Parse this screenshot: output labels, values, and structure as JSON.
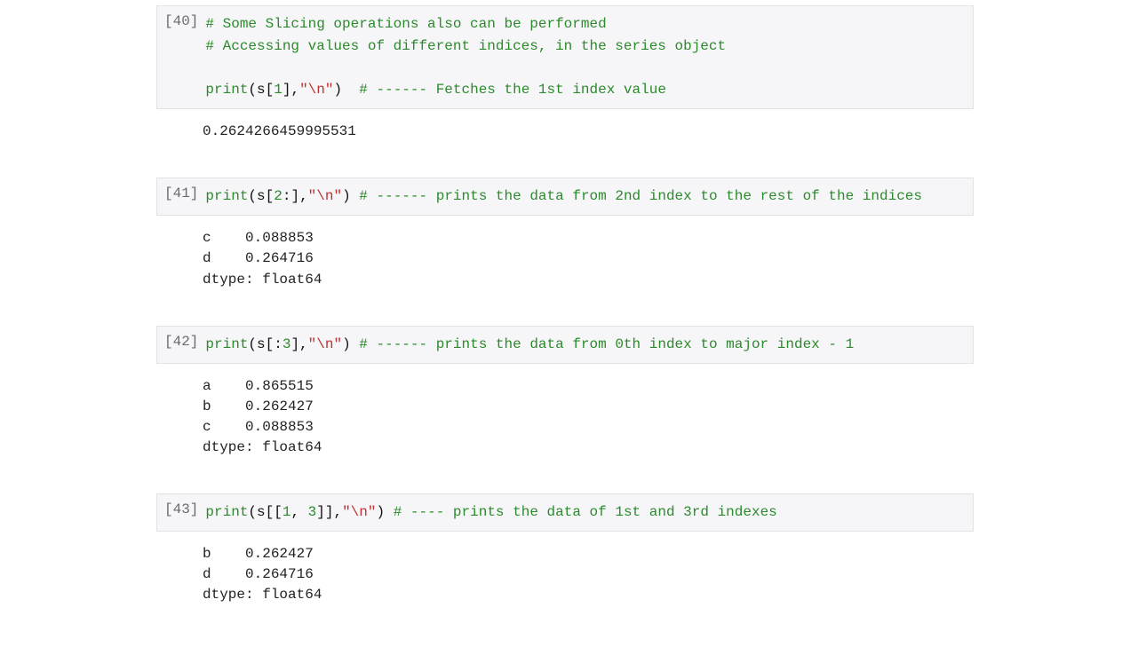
{
  "cells": [
    {
      "prompt": "[40]",
      "code_html": "<span class='c'># Some Slicing operations also can be performed</span>\n<span class='c'># Accessing values of different indices, in the series object</span>\n\n<span class='k'>print</span><span class='p'>(</span><span class='n'>s</span><span class='p'>[</span><span class='m'>1</span><span class='p'>],</span><span class='s'>\"\\n\"</span><span class='p'>)</span>  <span class='c'># ------ Fetches the 1st index value</span>",
      "output": "0.2624266459995531 "
    },
    {
      "prompt": "[41]",
      "code_html": "<span class='k'>print</span><span class='p'>(</span><span class='n'>s</span><span class='p'>[</span><span class='m'>2</span><span class='p'>:],</span><span class='s'>\"\\n\"</span><span class='p'>)</span> <span class='c'># ------ prints the data from 2nd index to the rest of the indices</span>",
      "output": "c    0.088853\nd    0.264716\ndtype: float64 "
    },
    {
      "prompt": "[42]",
      "code_html": "<span class='k'>print</span><span class='p'>(</span><span class='n'>s</span><span class='p'>[:</span><span class='m'>3</span><span class='p'>],</span><span class='s'>\"\\n\"</span><span class='p'>)</span> <span class='c'># ------ prints the data from 0th index to major index - 1</span>",
      "output": "a    0.865515\nb    0.262427\nc    0.088853\ndtype: float64 "
    },
    {
      "prompt": "[43]",
      "code_html": "<span class='k'>print</span><span class='p'>(</span><span class='n'>s</span><span class='p'>[[</span><span class='m'>1</span><span class='p'>, </span><span class='m'>3</span><span class='p'>]],</span><span class='s'>\"\\n\"</span><span class='p'>)</span> <span class='c'># ---- prints the data of 1st and 3rd indexes</span>",
      "output": "b    0.262427\nd    0.264716\ndtype: float64 "
    }
  ]
}
